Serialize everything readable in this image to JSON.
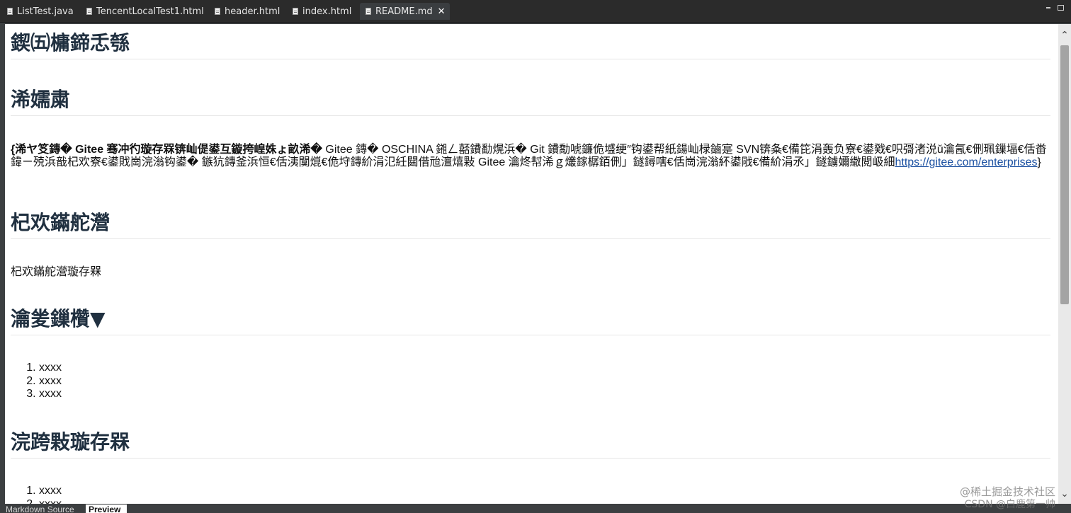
{
  "tabs": [
    {
      "label": "ListTest.java",
      "icon": "java-file-icon"
    },
    {
      "label": "TencentLocalTest1.html",
      "icon": "html-file-icon"
    },
    {
      "label": "header.html",
      "icon": "html-file-icon"
    },
    {
      "label": "index.html",
      "icon": "html-file-icon"
    },
    {
      "label": "README.md",
      "icon": "markdown-file-icon",
      "active": true,
      "close": "✕"
    }
  ],
  "preview": {
    "heading1": "鍥㈤槦鍗忎綔",
    "heading2": "浠嬬粛",
    "intro_bold": "{浠ヤ笅鏄� Gitee 骞冲彴璇存槑锛屾偍鍙互鏇挎崲姝ょ畝浠�",
    "intro_text": " Gitee 鏄� OSCHINA 鎺ㄥ嚭鐨勫熀浜� Git 鐨勪唬鐮佹墭绠″钩鍙帮紙鍚屾椂鏀寔 SVN锛夈€備笓涓轰负寮€鍙戣€呮彁渚涚ǔ瀹氥€侀珮鏁堛€佸畨鍏ㄧ殑浜戠杞欢寮€鍙戝崗浣滃钩鍙� 鏃犺鏄釜浜恒€佸洟闃熴€佹垨鏄紒涓氾紝閮借兘澶熺敤 Gitee 瀹炵幇浠ｇ爜鎵樼銆侀」鐩鐞嗐€佸崗浣滃紑鍙戙€備紒涓氶」鐩鐪嬭繖閲岋細",
    "intro_link": "https://gitee.com/enterprises",
    "intro_end": "}",
    "heading3": "杞欢鏋舵瀯",
    "arch_text": "杞欢鏋舵瀯璇存槑",
    "heading4": "瀹夎鏁欑▼",
    "install_steps": [
      "xxxx",
      "xxxx",
      "xxxx"
    ],
    "heading5": "浣跨敤璇存槑",
    "usage_steps": [
      "xxxx",
      "xxxx"
    ]
  },
  "bottom_tabs": {
    "source": "Markdown Source",
    "preview": "Preview"
  },
  "watermark": {
    "line1": "@稀土掘金技术社区",
    "line2": "CSDN @白鹿第一帅"
  }
}
